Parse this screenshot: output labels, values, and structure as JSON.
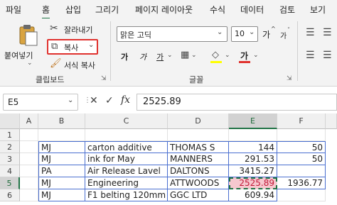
{
  "tabs": [
    "파일",
    "홈",
    "삽입",
    "그리기",
    "페이지 레이아웃",
    "수식",
    "데이터",
    "검토",
    "보기"
  ],
  "active_tab": "홈",
  "clipboard": {
    "paste_label": "붙여넣기",
    "cut_label": "잘라내기",
    "copy_label": "복사",
    "format_painter_label": "서식 복사",
    "group_label": "클립보드"
  },
  "font": {
    "font_name": "맑은 고딕",
    "font_size": "10",
    "increase_label": "가",
    "decrease_label": "가",
    "bold_label": "가",
    "italic_label": "가",
    "underline_label": "가",
    "font_color_label": "가",
    "group_label": "글꼴"
  },
  "colors": {
    "accent": "#217346",
    "highlight": "#ffff00",
    "font_red": "#e0322e",
    "copy_outline": "#e0322e"
  },
  "formula_bar": {
    "name_box": "E5",
    "fx_label": "fx",
    "value": "2525.89"
  },
  "grid": {
    "columns": [
      "A",
      "B",
      "C",
      "D",
      "E",
      "F"
    ],
    "selected_column": "E",
    "rows": [
      {
        "num": "1",
        "cells": [
          "",
          "",
          "",
          "",
          "",
          ""
        ]
      },
      {
        "num": "2",
        "cells": [
          "",
          "MJ",
          "carton additive",
          "THOMAS S",
          "144",
          "50"
        ]
      },
      {
        "num": "3",
        "cells": [
          "",
          "MJ",
          "ink for May",
          "MANNERS",
          "291.53",
          "50"
        ]
      },
      {
        "num": "4",
        "cells": [
          "",
          "PA",
          "Air Release Lavel",
          "DALTONS",
          "3415.27",
          ""
        ]
      },
      {
        "num": "5",
        "cells": [
          "",
          "MJ",
          "Engineering",
          "ATTWOODS",
          "2525.89",
          "1936.77"
        ]
      },
      {
        "num": "6",
        "cells": [
          "",
          "MJ",
          "F1 belting 120mm",
          "GGC LTD",
          "609.94",
          ""
        ]
      }
    ],
    "active_row": "5"
  }
}
